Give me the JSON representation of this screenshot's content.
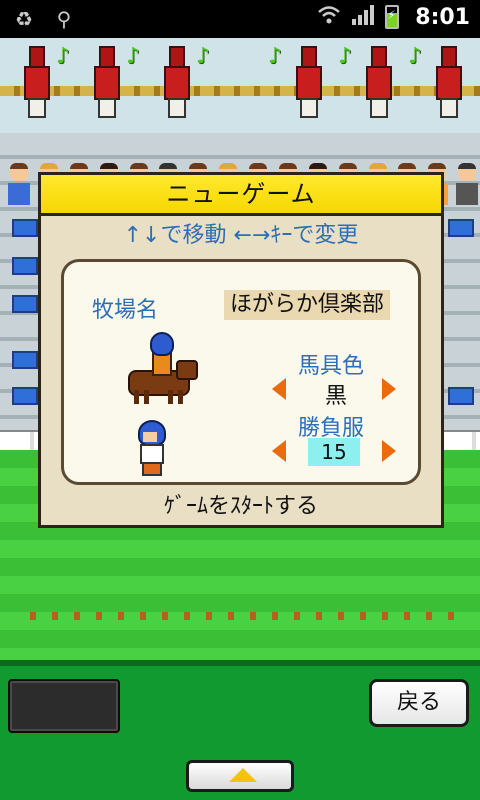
{
  "status_bar": {
    "time": "8:01",
    "icons": [
      "recycle-icon",
      "usb-icon",
      "wifi-icon",
      "signal-icon",
      "battery-charging-icon"
    ]
  },
  "dialog": {
    "title": "ニューゲーム",
    "hint": "↑↓で移動 ←→ｷｰで変更",
    "farm_label": "牧場名",
    "farm_name": "ほがらか倶楽部",
    "tack_color_label": "馬具色",
    "tack_color_value": "黒",
    "silks_label": "勝負服",
    "silks_value": "15",
    "start_label": "ｹﾞｰﾑをｽﾀｰﾄする"
  },
  "bottom_bar": {
    "back_label": "戻る"
  },
  "colors": {
    "accent_blue": "#2c6fb8",
    "title_yellow": "#f6d700",
    "arrow_orange": "#ea6a0c",
    "silks_highlight": "#8df0ef",
    "turf_green": "#3bbf36"
  }
}
